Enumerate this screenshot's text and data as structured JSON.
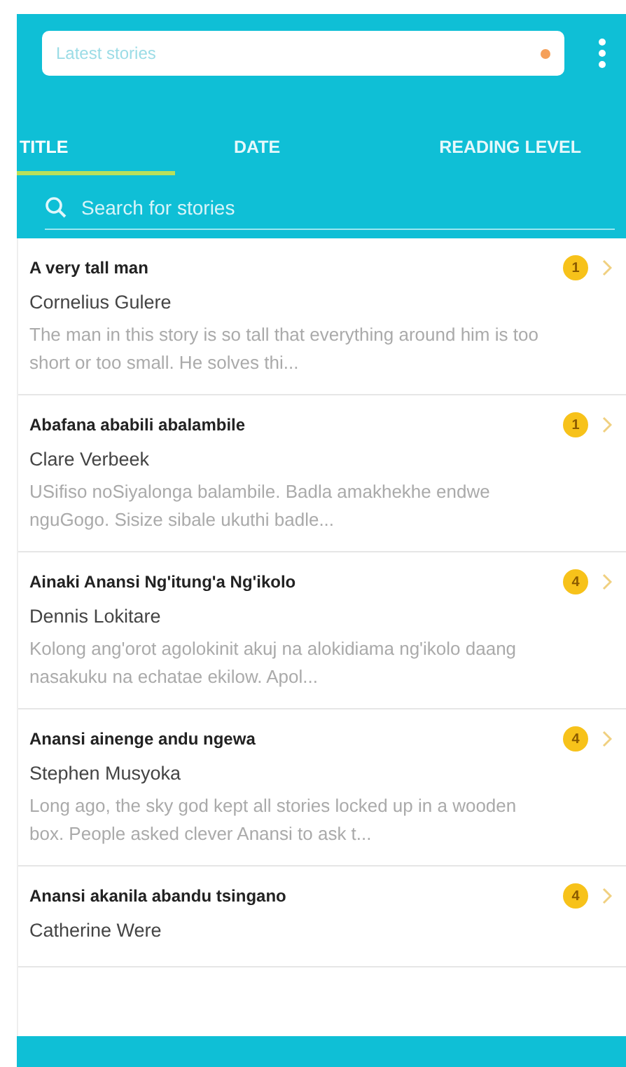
{
  "dropdown": {
    "value": "Latest stories"
  },
  "tabs": [
    {
      "label": "TITLE",
      "selected": true
    },
    {
      "label": "DATE",
      "selected": false
    },
    {
      "label": "READING LEVEL",
      "selected": false
    }
  ],
  "search": {
    "placeholder": "Search for stories"
  },
  "stories": [
    {
      "title": "A very tall man",
      "author": "Cornelius Gulere",
      "summary": "The man in this story is so tall that everything around him is too short or too small. He solves thi...",
      "level": "1"
    },
    {
      "title": "Abafana ababili abalambile",
      "author": "Clare Verbeek",
      "summary": "USifiso noSiyalonga balambile. Badla amakhekhe endwe nguGogo. Sisize sibale ukuthi badle...",
      "level": "1"
    },
    {
      "title": "Ainaki Anansi Ng'itung'a Ng'ikolo",
      "author": "Dennis Lokitare",
      "summary": "Kolong ang'orot agolokinit akuj na alokidiama ng'ikolo daang nasakuku na echatae ekilow. Apol...",
      "level": "4"
    },
    {
      "title": "Anansi ainenge andu ngewa",
      "author": "Stephen Musyoka",
      "summary": "Long ago, the sky god kept all stories locked up in a wooden box. People asked clever Anansi to ask t...",
      "level": "4"
    },
    {
      "title": "Anansi akanila abandu tsingano",
      "author": "Catherine Were",
      "level": "4"
    }
  ]
}
